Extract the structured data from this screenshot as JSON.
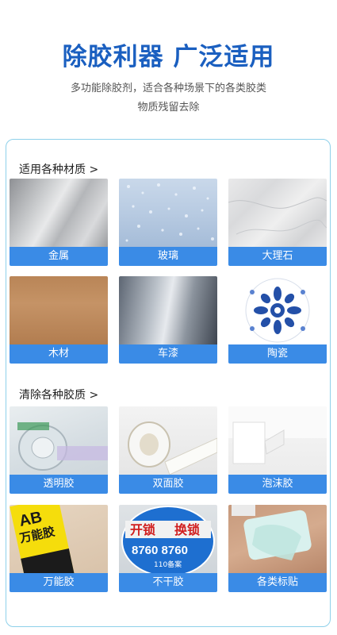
{
  "header": {
    "title": "除胶利器 广泛适用",
    "subtitle_line1": "多功能除胶剂，适合各种场景下的各类胶类",
    "subtitle_line2": "物质残留去除"
  },
  "sections": [
    {
      "title": "适用各种材质 >",
      "items": [
        {
          "label": "金属",
          "icon": "metal-surface"
        },
        {
          "label": "玻璃",
          "icon": "glass-surface"
        },
        {
          "label": "大理石",
          "icon": "marble-surface"
        },
        {
          "label": "木材",
          "icon": "wood-surface"
        },
        {
          "label": "车漆",
          "icon": "car-paint-surface"
        },
        {
          "label": "陶瓷",
          "icon": "ceramic-plate"
        }
      ]
    },
    {
      "title": "清除各种胶质 >",
      "items": [
        {
          "label": "透明胶",
          "icon": "clear-tape"
        },
        {
          "label": "双面胶",
          "icon": "double-sided-tape"
        },
        {
          "label": "泡沫胶",
          "icon": "foam-tape"
        },
        {
          "label": "万能胶",
          "icon": "ab-glue-tube",
          "image_text": [
            "AB",
            "万能胶"
          ]
        },
        {
          "label": "不干胶",
          "icon": "sticker-sign",
          "image_text": [
            "开锁",
            "换锁",
            "8760 8760",
            "110备案"
          ]
        },
        {
          "label": "各类标贴",
          "icon": "label-sticker"
        }
      ]
    }
  ],
  "colors": {
    "headline": "#1a5fc0",
    "label_bar": "#3a8be6",
    "panel_border": "#8ed0ea"
  }
}
